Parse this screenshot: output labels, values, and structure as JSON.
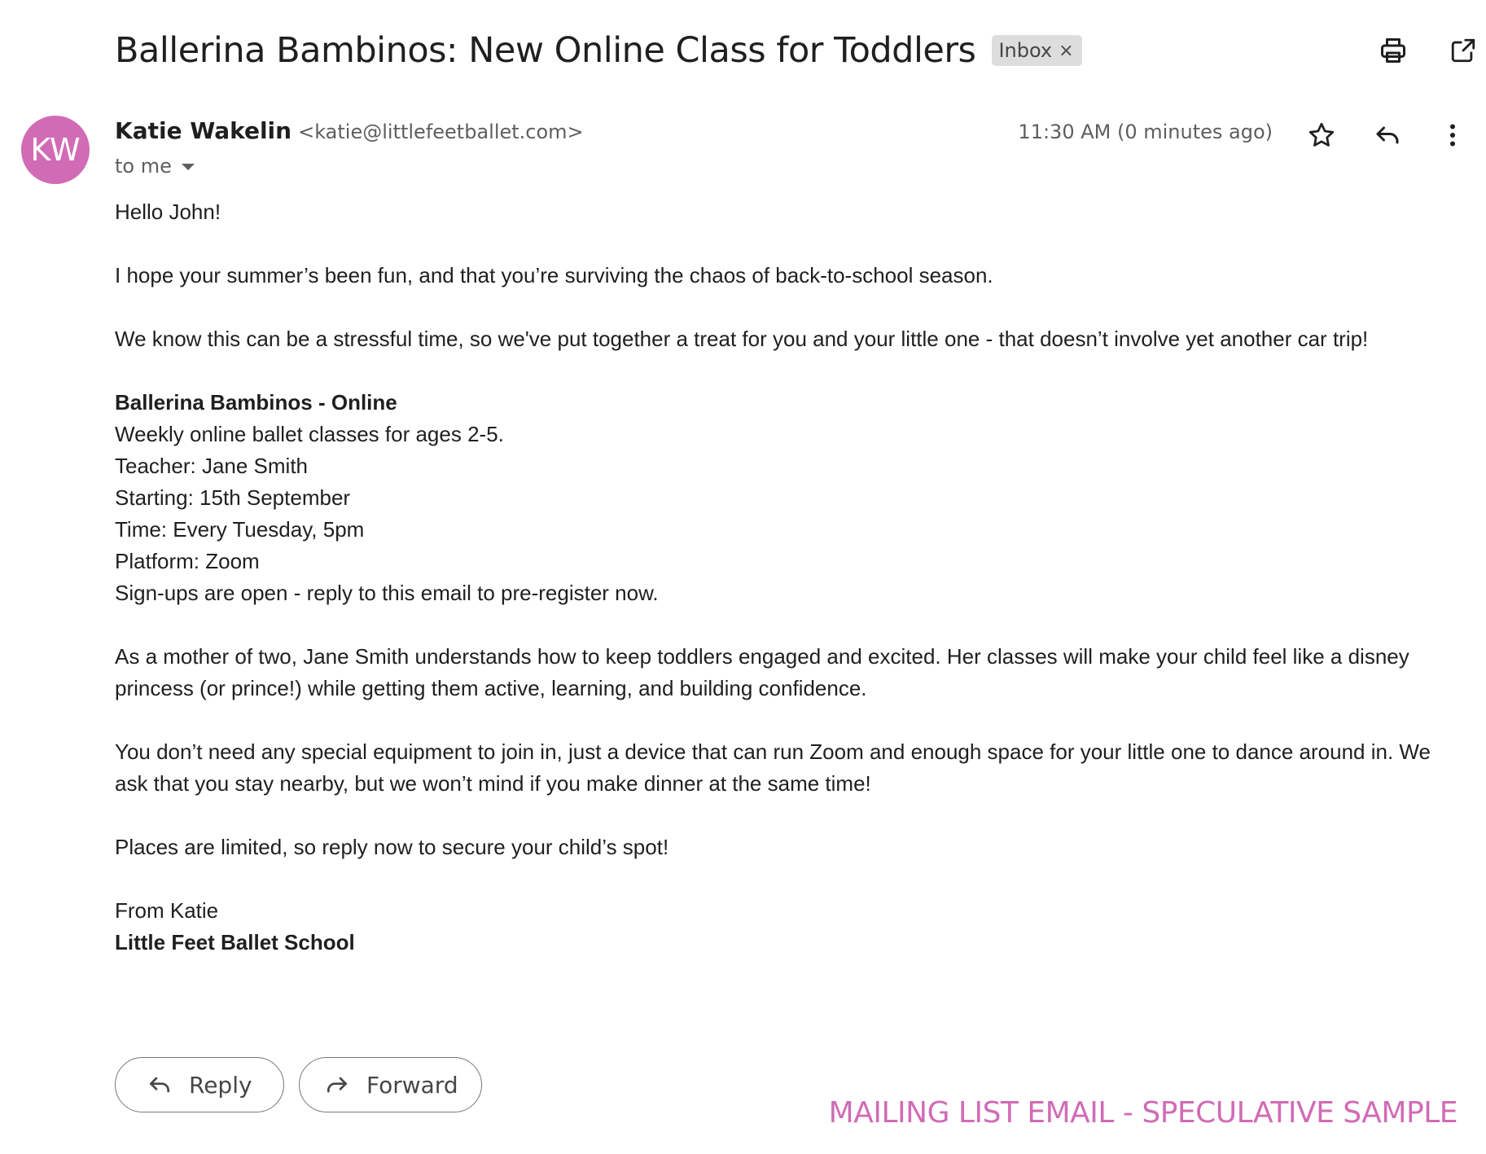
{
  "email": {
    "subject": "Ballerina Bambinos: New Online Class for Toddlers",
    "label": "Inbox",
    "label_remove": "×",
    "sender": {
      "initials": "KW",
      "name": "Katie Wakelin",
      "email": "<katie@littlefeetballet.com>",
      "avatar_color": "#d16bb5"
    },
    "recipient": "to me",
    "timestamp": "11:30 AM (0 minutes ago)",
    "body": {
      "greeting": "Hello John!",
      "para1": "I hope your summer’s been fun, and that you’re surviving the chaos of back-to-school season.",
      "para2": "We know this can be a stressful time, so we've put together a treat for you and your little one - that doesn’t involve yet another car trip!",
      "class_block": {
        "title": "Ballerina Bambinos - Online",
        "lines": [
          "Weekly online ballet classes for ages 2-5.",
          "Teacher: Jane Smith",
          "Starting: 15th September",
          "Time: Every Tuesday, 5pm",
          "Platform: Zoom",
          "Sign-ups are open - reply to this email to pre-register now."
        ]
      },
      "para3": "As a mother of two, Jane Smith understands how to keep toddlers engaged and excited. Her classes will make your child feel like a disney princess (or prince!) while getting them active, learning, and building confidence.",
      "para4": "You don’t need any special equipment to join in, just a device that can run Zoom and enough space for your little one to dance around in. We ask that you stay nearby, but we won’t mind if you make dinner at the same time!",
      "para5": "Places are limited, so reply now to secure your child’s spot!",
      "signoff": "From Katie",
      "signature": "Little Feet Ballet School"
    }
  },
  "actions": {
    "reply_label": "Reply",
    "forward_label": "Forward"
  },
  "icons": {
    "print": "print-icon",
    "open_new_window": "open-in-new-window-icon",
    "star": "star-icon",
    "reply": "reply-icon",
    "more": "more-vert-icon",
    "forward": "forward-icon"
  },
  "watermark": "MAILING LIST EMAIL - SPECULATIVE SAMPLE",
  "colors": {
    "accent": "#d16bb5",
    "text": "#1f1f1f",
    "muted": "#5e5e5e",
    "chip": "#dddddd"
  }
}
